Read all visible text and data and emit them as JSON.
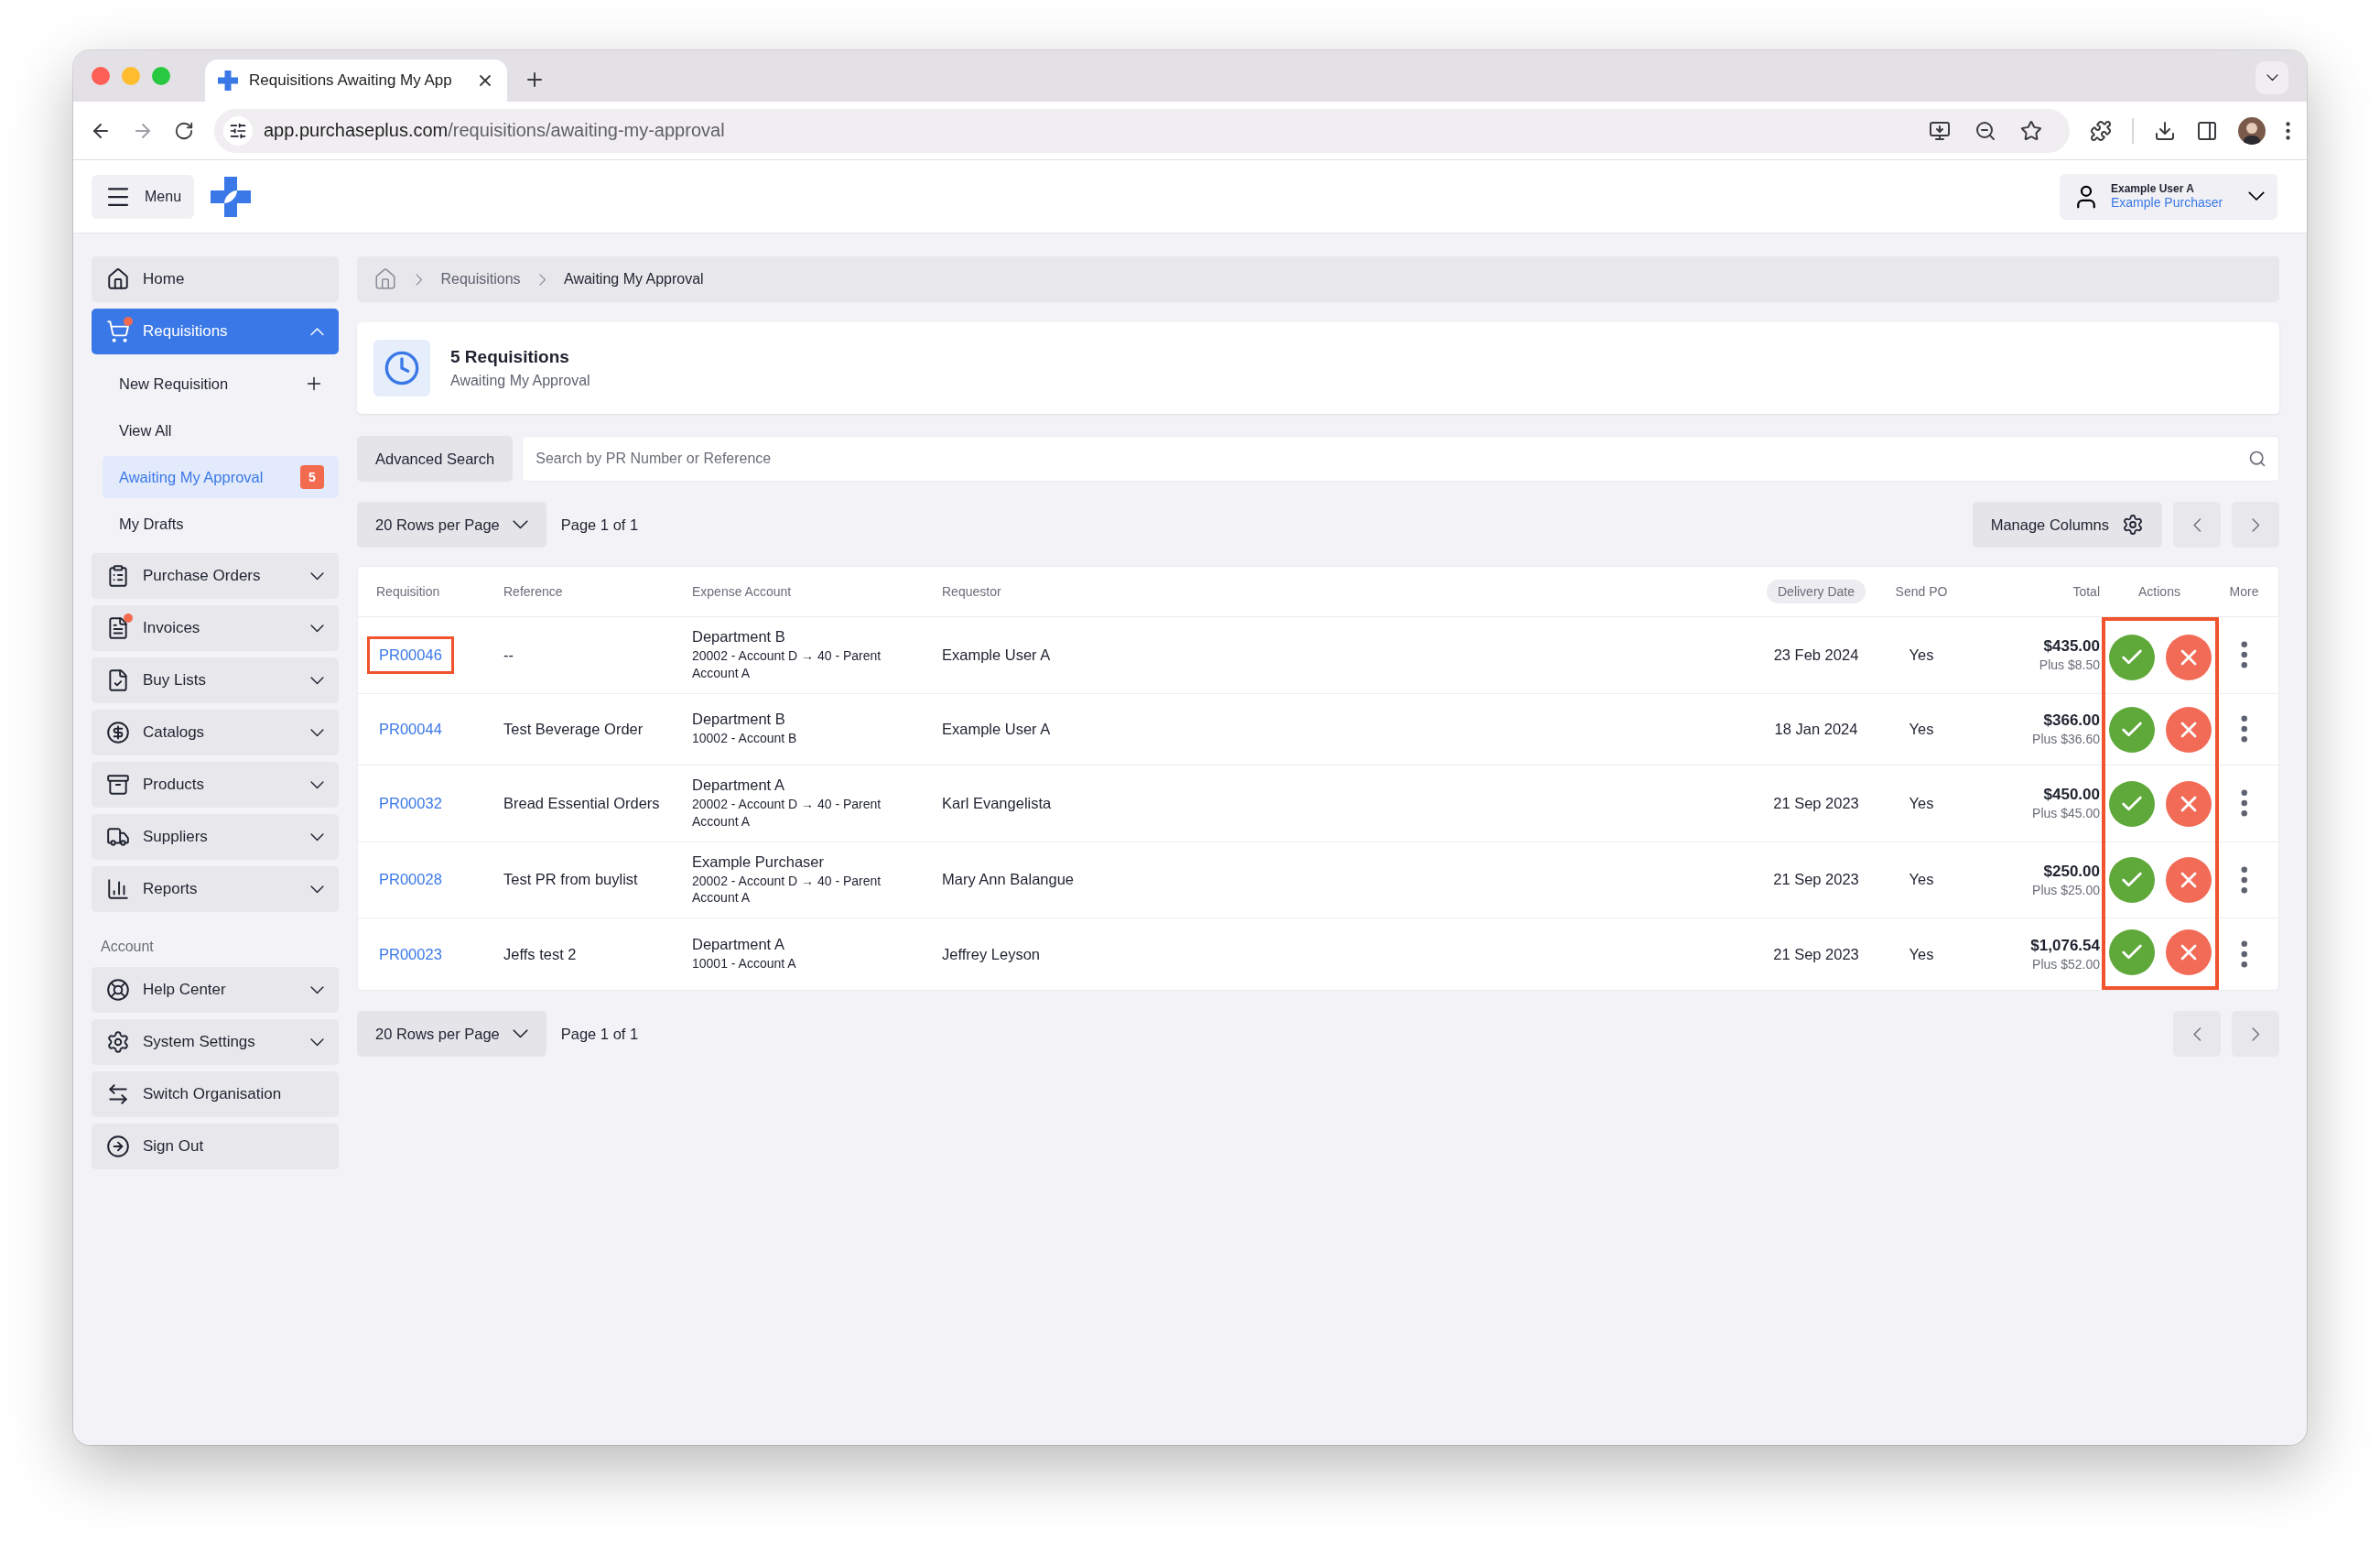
{
  "browser": {
    "tab_title": "Requisitions Awaiting My App",
    "url_host": "app.purchaseplus.com",
    "url_path": "/requisitions/awaiting-my-approval"
  },
  "header": {
    "menu_label": "Menu",
    "user": {
      "name": "Example User A",
      "organisation": "Example Purchaser"
    }
  },
  "sidebar": {
    "items": [
      {
        "kind": "link",
        "label": "Home",
        "selected": false,
        "notification": false
      },
      {
        "kind": "group",
        "label": "Requisitions",
        "selected": true,
        "expanded": true,
        "notification": true,
        "children": [
          {
            "label": "New Requisition",
            "selected": false,
            "add_button": true
          },
          {
            "label": "View All",
            "selected": false,
            "add_button": false
          },
          {
            "label": "Awaiting My Approval",
            "selected": true,
            "add_button": false,
            "badge": "5"
          },
          {
            "label": "My Drafts",
            "selected": false,
            "add_button": false
          }
        ]
      },
      {
        "kind": "group",
        "label": "Purchase Orders",
        "selected": false,
        "expanded": false,
        "notification": false
      },
      {
        "kind": "group",
        "label": "Invoices",
        "selected": false,
        "expanded": false,
        "notification": true
      },
      {
        "kind": "group",
        "label": "Buy Lists",
        "selected": false,
        "expanded": false,
        "notification": false
      },
      {
        "kind": "group",
        "label": "Catalogs",
        "selected": false,
        "expanded": false,
        "notification": false
      },
      {
        "kind": "group",
        "label": "Products",
        "selected": false,
        "expanded": false,
        "notification": false
      },
      {
        "kind": "group",
        "label": "Suppliers",
        "selected": false,
        "expanded": false,
        "notification": false
      },
      {
        "kind": "group",
        "label": "Reports",
        "selected": false,
        "expanded": false,
        "notification": false
      }
    ],
    "section_label": "Account",
    "account_items": [
      {
        "kind": "group",
        "label": "Help Center",
        "selected": false,
        "expanded": false,
        "notification": false
      },
      {
        "kind": "group",
        "label": "System Settings",
        "selected": false,
        "expanded": false,
        "notification": false
      },
      {
        "kind": "link",
        "label": "Switch Organisation",
        "selected": false,
        "notification": false
      },
      {
        "kind": "link",
        "label": "Sign Out",
        "selected": false,
        "notification": false
      }
    ]
  },
  "breadcrumb": [
    "Requisitions",
    "Awaiting My Approval"
  ],
  "summary": {
    "title": "5 Requisitions",
    "subtitle": "Awaiting My Approval"
  },
  "search": {
    "button": "Advanced Search",
    "placeholder": "Search by PR Number or Reference"
  },
  "pagination_top": {
    "rows_per_page": "20 Rows per Page",
    "page": "Page 1 of 1",
    "manage_columns": "Manage Columns"
  },
  "table": {
    "actions_highlighted": true,
    "columns": [
      {
        "label": "Requisition",
        "sorted": false
      },
      {
        "label": "Reference",
        "sorted": false
      },
      {
        "label": "Expense Account",
        "sorted": false
      },
      {
        "label": "Requestor",
        "sorted": false
      },
      {
        "label": "Delivery Date",
        "sorted": true
      },
      {
        "label": "Send PO",
        "sorted": false
      },
      {
        "label": "Total",
        "sorted": false
      },
      {
        "label": "Actions",
        "sorted": false
      },
      {
        "label": "More",
        "sorted": false
      }
    ],
    "rows": [
      {
        "requisition": "PR00046",
        "highlighted": true,
        "reference": "--",
        "department": "Department B",
        "account": "20002 - Account D → 40 - Parent Account A",
        "requestor": "Example User A",
        "delivery_date": "23 Feb 2024",
        "send_po": "Yes",
        "total": "$435.00",
        "tax": "Plus $8.50"
      },
      {
        "requisition": "PR00044",
        "highlighted": false,
        "reference": "Test Beverage Order",
        "department": "Department B",
        "account": "10002 - Account B",
        "requestor": "Example User A",
        "delivery_date": "18 Jan 2024",
        "send_po": "Yes",
        "total": "$366.00",
        "tax": "Plus $36.60"
      },
      {
        "requisition": "PR00032",
        "highlighted": false,
        "reference": "Bread Essential Orders",
        "department": "Department A",
        "account": "20002 - Account D → 40 - Parent Account A",
        "requestor": "Karl Evangelista",
        "delivery_date": "21 Sep 2023",
        "send_po": "Yes",
        "total": "$450.00",
        "tax": "Plus $45.00"
      },
      {
        "requisition": "PR00028",
        "highlighted": false,
        "reference": "Test PR from buylist",
        "department": "Example Purchaser",
        "account": "20002 - Account D → 40 - Parent Account A",
        "requestor": "Mary Ann Balangue",
        "delivery_date": "21 Sep 2023",
        "send_po": "Yes",
        "total": "$250.00",
        "tax": "Plus $25.00"
      },
      {
        "requisition": "PR00023",
        "highlighted": false,
        "reference": "Jeffs test 2",
        "department": "Department A",
        "account": "10001 - Account A",
        "requestor": "Jeffrey Leyson",
        "delivery_date": "21 Sep 2023",
        "send_po": "Yes",
        "total": "$1,076.54",
        "tax": "Plus $52.00"
      }
    ]
  },
  "pagination_bottom": {
    "rows_per_page": "20 Rows per Page",
    "page": "Page 1 of 1"
  }
}
